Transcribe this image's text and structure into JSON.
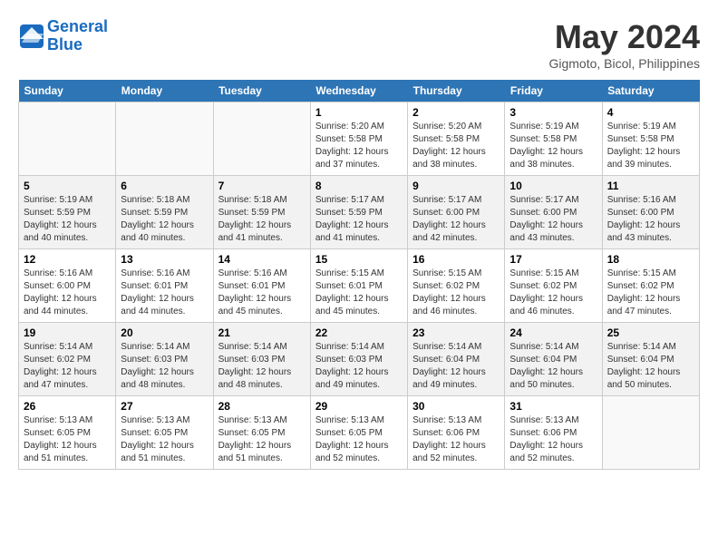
{
  "header": {
    "logo_line1": "General",
    "logo_line2": "Blue",
    "month": "May 2024",
    "location": "Gigmoto, Bicol, Philippines"
  },
  "weekdays": [
    "Sunday",
    "Monday",
    "Tuesday",
    "Wednesday",
    "Thursday",
    "Friday",
    "Saturday"
  ],
  "weeks": [
    [
      {
        "day": "",
        "info": ""
      },
      {
        "day": "",
        "info": ""
      },
      {
        "day": "",
        "info": ""
      },
      {
        "day": "1",
        "info": "Sunrise: 5:20 AM\nSunset: 5:58 PM\nDaylight: 12 hours\nand 37 minutes."
      },
      {
        "day": "2",
        "info": "Sunrise: 5:20 AM\nSunset: 5:58 PM\nDaylight: 12 hours\nand 38 minutes."
      },
      {
        "day": "3",
        "info": "Sunrise: 5:19 AM\nSunset: 5:58 PM\nDaylight: 12 hours\nand 38 minutes."
      },
      {
        "day": "4",
        "info": "Sunrise: 5:19 AM\nSunset: 5:58 PM\nDaylight: 12 hours\nand 39 minutes."
      }
    ],
    [
      {
        "day": "5",
        "info": "Sunrise: 5:19 AM\nSunset: 5:59 PM\nDaylight: 12 hours\nand 40 minutes."
      },
      {
        "day": "6",
        "info": "Sunrise: 5:18 AM\nSunset: 5:59 PM\nDaylight: 12 hours\nand 40 minutes."
      },
      {
        "day": "7",
        "info": "Sunrise: 5:18 AM\nSunset: 5:59 PM\nDaylight: 12 hours\nand 41 minutes."
      },
      {
        "day": "8",
        "info": "Sunrise: 5:17 AM\nSunset: 5:59 PM\nDaylight: 12 hours\nand 41 minutes."
      },
      {
        "day": "9",
        "info": "Sunrise: 5:17 AM\nSunset: 6:00 PM\nDaylight: 12 hours\nand 42 minutes."
      },
      {
        "day": "10",
        "info": "Sunrise: 5:17 AM\nSunset: 6:00 PM\nDaylight: 12 hours\nand 43 minutes."
      },
      {
        "day": "11",
        "info": "Sunrise: 5:16 AM\nSunset: 6:00 PM\nDaylight: 12 hours\nand 43 minutes."
      }
    ],
    [
      {
        "day": "12",
        "info": "Sunrise: 5:16 AM\nSunset: 6:00 PM\nDaylight: 12 hours\nand 44 minutes."
      },
      {
        "day": "13",
        "info": "Sunrise: 5:16 AM\nSunset: 6:01 PM\nDaylight: 12 hours\nand 44 minutes."
      },
      {
        "day": "14",
        "info": "Sunrise: 5:16 AM\nSunset: 6:01 PM\nDaylight: 12 hours\nand 45 minutes."
      },
      {
        "day": "15",
        "info": "Sunrise: 5:15 AM\nSunset: 6:01 PM\nDaylight: 12 hours\nand 45 minutes."
      },
      {
        "day": "16",
        "info": "Sunrise: 5:15 AM\nSunset: 6:02 PM\nDaylight: 12 hours\nand 46 minutes."
      },
      {
        "day": "17",
        "info": "Sunrise: 5:15 AM\nSunset: 6:02 PM\nDaylight: 12 hours\nand 46 minutes."
      },
      {
        "day": "18",
        "info": "Sunrise: 5:15 AM\nSunset: 6:02 PM\nDaylight: 12 hours\nand 47 minutes."
      }
    ],
    [
      {
        "day": "19",
        "info": "Sunrise: 5:14 AM\nSunset: 6:02 PM\nDaylight: 12 hours\nand 47 minutes."
      },
      {
        "day": "20",
        "info": "Sunrise: 5:14 AM\nSunset: 6:03 PM\nDaylight: 12 hours\nand 48 minutes."
      },
      {
        "day": "21",
        "info": "Sunrise: 5:14 AM\nSunset: 6:03 PM\nDaylight: 12 hours\nand 48 minutes."
      },
      {
        "day": "22",
        "info": "Sunrise: 5:14 AM\nSunset: 6:03 PM\nDaylight: 12 hours\nand 49 minutes."
      },
      {
        "day": "23",
        "info": "Sunrise: 5:14 AM\nSunset: 6:04 PM\nDaylight: 12 hours\nand 49 minutes."
      },
      {
        "day": "24",
        "info": "Sunrise: 5:14 AM\nSunset: 6:04 PM\nDaylight: 12 hours\nand 50 minutes."
      },
      {
        "day": "25",
        "info": "Sunrise: 5:14 AM\nSunset: 6:04 PM\nDaylight: 12 hours\nand 50 minutes."
      }
    ],
    [
      {
        "day": "26",
        "info": "Sunrise: 5:13 AM\nSunset: 6:05 PM\nDaylight: 12 hours\nand 51 minutes."
      },
      {
        "day": "27",
        "info": "Sunrise: 5:13 AM\nSunset: 6:05 PM\nDaylight: 12 hours\nand 51 minutes."
      },
      {
        "day": "28",
        "info": "Sunrise: 5:13 AM\nSunset: 6:05 PM\nDaylight: 12 hours\nand 51 minutes."
      },
      {
        "day": "29",
        "info": "Sunrise: 5:13 AM\nSunset: 6:05 PM\nDaylight: 12 hours\nand 52 minutes."
      },
      {
        "day": "30",
        "info": "Sunrise: 5:13 AM\nSunset: 6:06 PM\nDaylight: 12 hours\nand 52 minutes."
      },
      {
        "day": "31",
        "info": "Sunrise: 5:13 AM\nSunset: 6:06 PM\nDaylight: 12 hours\nand 52 minutes."
      },
      {
        "day": "",
        "info": ""
      }
    ]
  ]
}
